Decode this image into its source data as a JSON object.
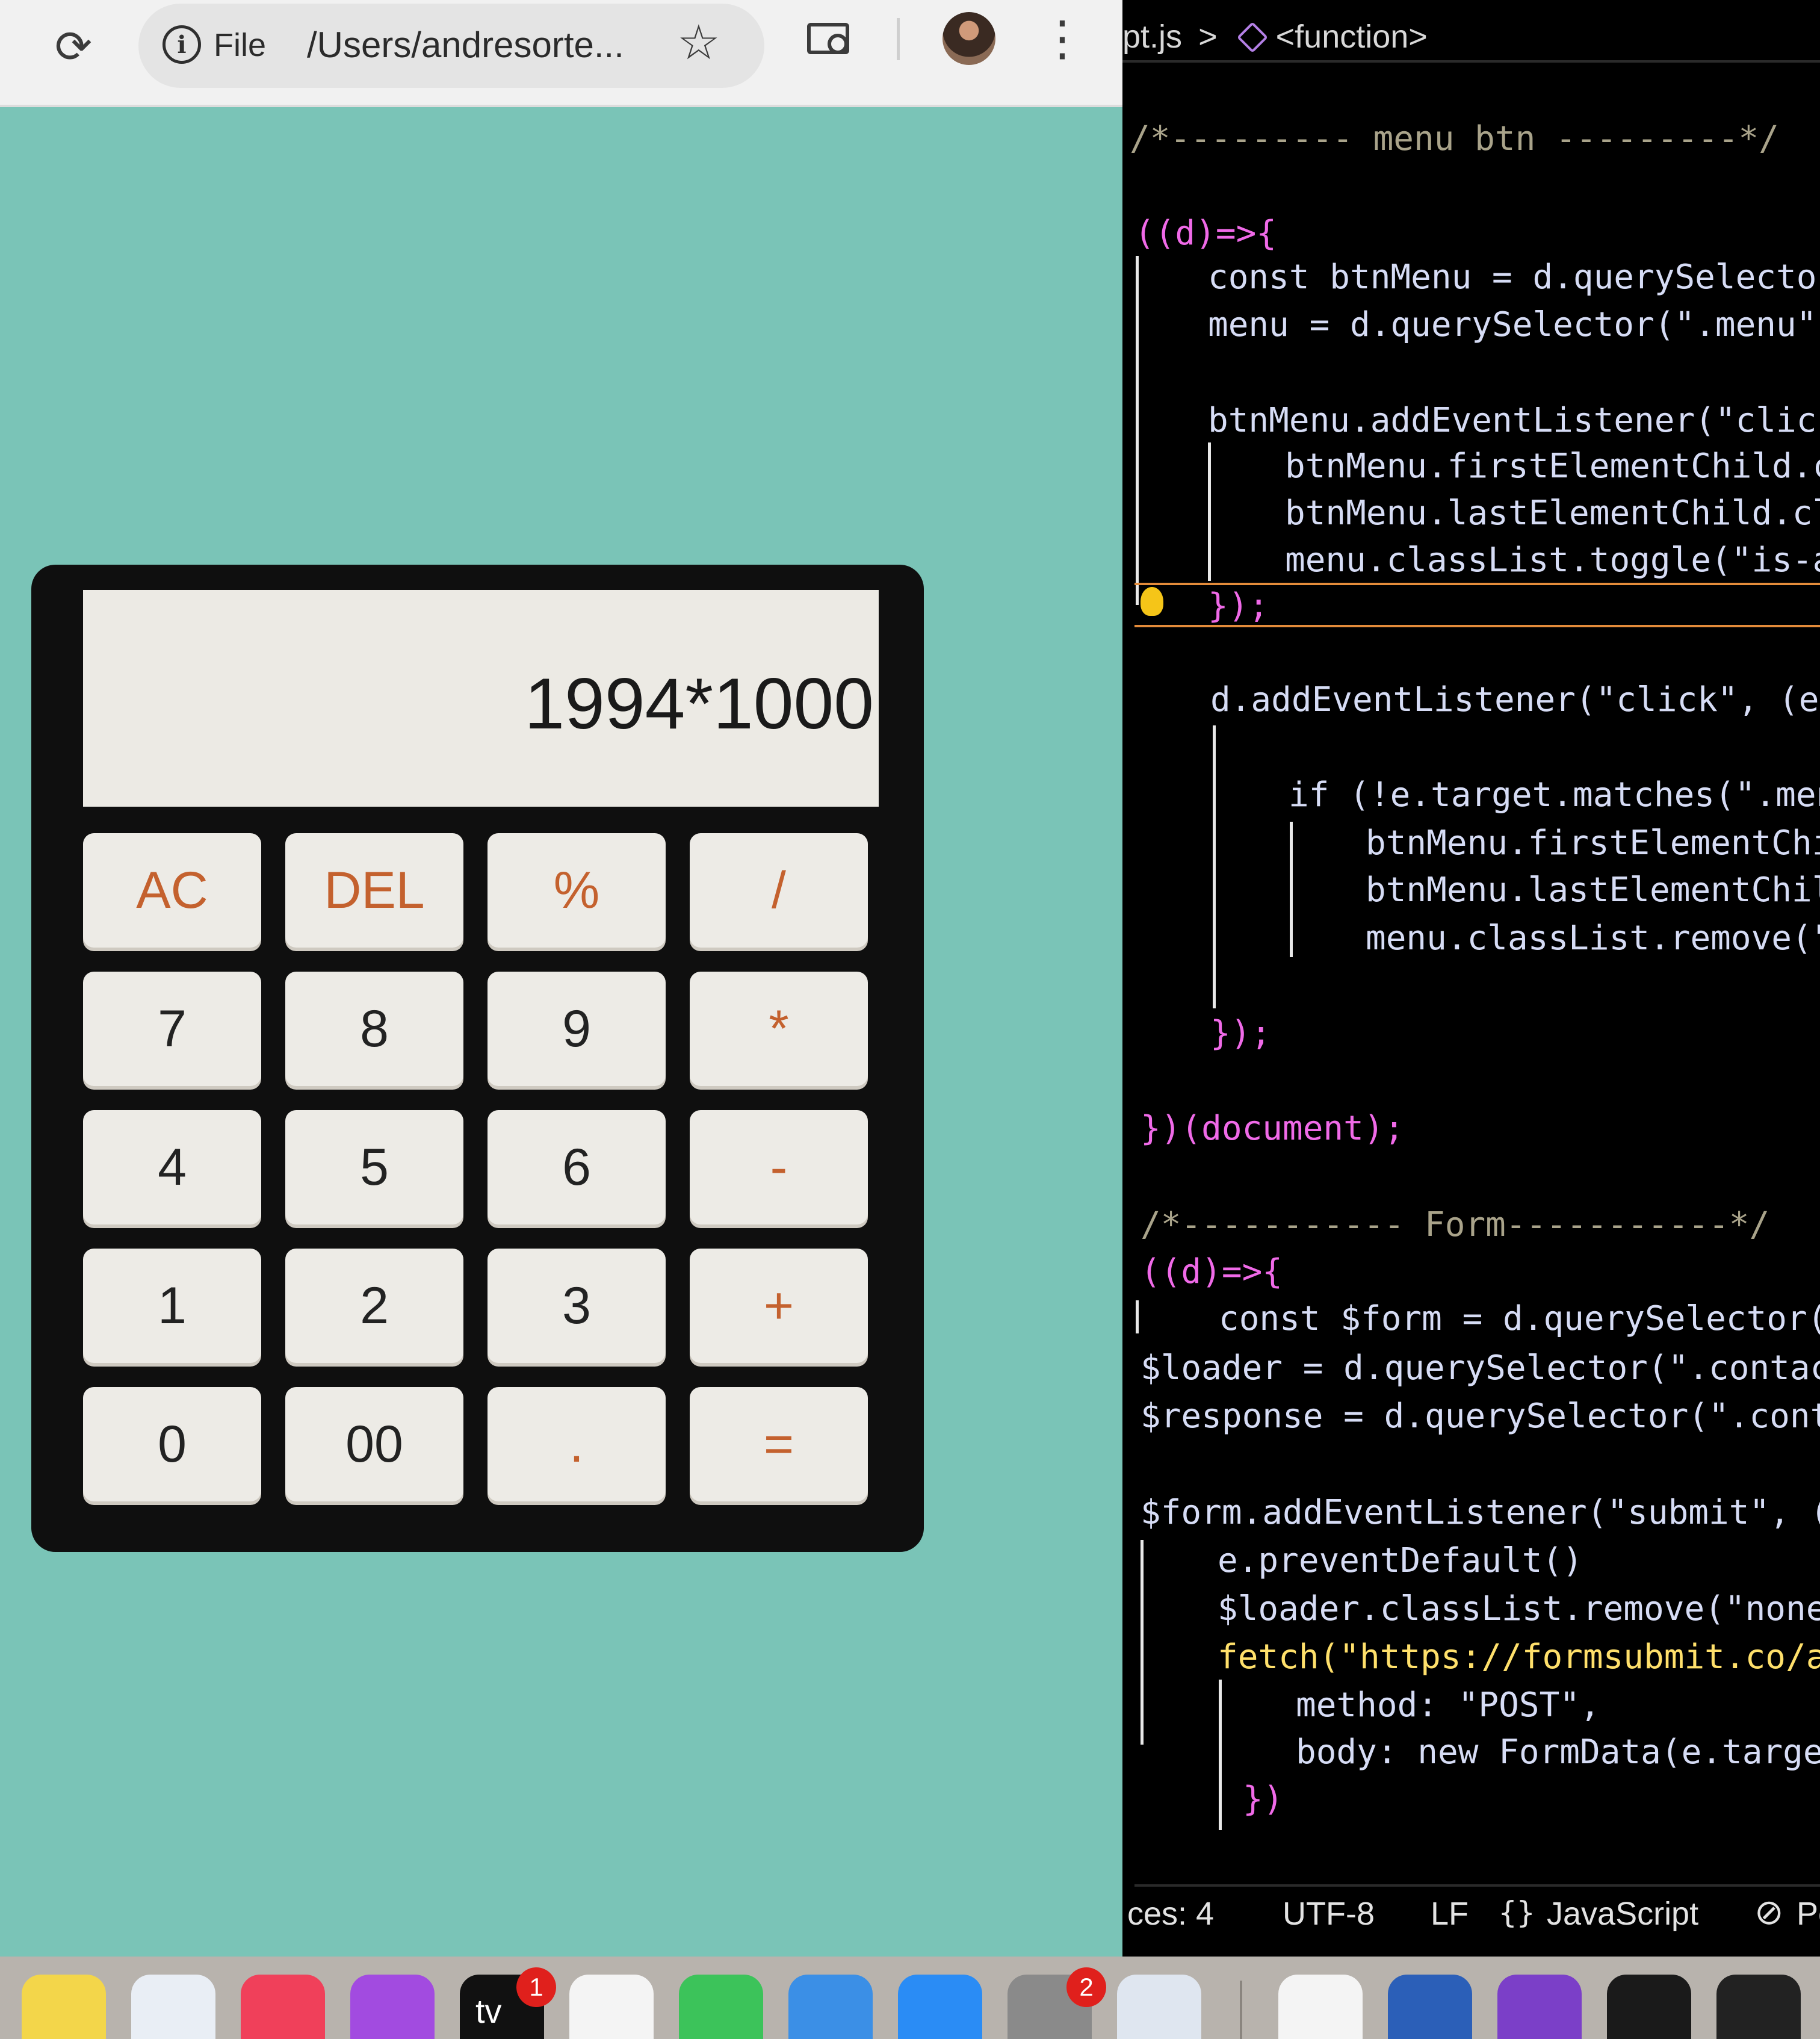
{
  "browser": {
    "address": {
      "security_label": "File",
      "url": "/Users/andresorte..."
    }
  },
  "calculator": {
    "display": "1994*1000",
    "keys": [
      {
        "label": "AC",
        "role": "operator"
      },
      {
        "label": "DEL",
        "role": "operator"
      },
      {
        "label": "%",
        "role": "operator"
      },
      {
        "label": "/",
        "role": "operator"
      },
      {
        "label": "7",
        "role": "digit"
      },
      {
        "label": "8",
        "role": "digit"
      },
      {
        "label": "9",
        "role": "digit"
      },
      {
        "label": "*",
        "role": "operator"
      },
      {
        "label": "4",
        "role": "digit"
      },
      {
        "label": "5",
        "role": "digit"
      },
      {
        "label": "6",
        "role": "digit"
      },
      {
        "label": "-",
        "role": "operator"
      },
      {
        "label": "1",
        "role": "digit"
      },
      {
        "label": "2",
        "role": "digit"
      },
      {
        "label": "3",
        "role": "digit"
      },
      {
        "label": "+",
        "role": "operator"
      },
      {
        "label": "0",
        "role": "digit"
      },
      {
        "label": "00",
        "role": "digit"
      },
      {
        "label": ".",
        "role": "operator"
      },
      {
        "label": "=",
        "role": "operator"
      }
    ]
  },
  "editor": {
    "breadcrumb": {
      "file": "pt.js",
      "separator": ">",
      "symbol": "<function>"
    },
    "code_lines": [
      "/*--------- menu btn ---------*/",
      "((d)=>{",
      "const btnMenu = d.querySelector(\"",
      "menu = d.querySelector(\".menu\");",
      "btnMenu.addEventListener(\"click\",",
      "btnMenu.firstElementChild.cl",
      "btnMenu.lastElementChild.cla",
      "menu.classList.toggle(\"is-ac",
      "});",
      "d.addEventListener(\"click\", (e)",
      "if (!e.target.matches(\".menu",
      "btnMenu.firstElementChil",
      "btnMenu.lastElementChild",
      "menu.classList.remove(\"i",
      "});",
      "})(document);",
      "/*----------- Form-----------*/",
      "((d)=>{",
      "const $form = d.querySelector(\".",
      "$loader = d.querySelector(\".contact-",
      "$response = d.querySelector(\".conta",
      "$form.addEventListener(\"submit\", (e",
      "e.preventDefault()",
      "$loader.classList.remove(\"none\"",
      "fetch(\"https://formsubmit.co/aj",
      "method: \"POST\",",
      "body: new FormData(e.target",
      "})"
    ],
    "status": {
      "spaces": "ces: 4",
      "encoding": "UTF-8",
      "eol": "LF",
      "language": "JavaScript",
      "extra": "Pc"
    }
  },
  "dock": {
    "badges": {
      "tv": "1",
      "settings": "2"
    },
    "tv_label": "tv"
  },
  "colors": {
    "page_bg": "#7ac4b7",
    "calc_body": "#0f0f0f",
    "key_bg": "#edebe6",
    "operator_text": "#c4612e",
    "comment": "#a9a38a",
    "keyword": "#6aa9ff",
    "function": "#ffe06b",
    "string": "#f0a070",
    "variable": "#d6dcf5",
    "highlight_line": "#e38b3a"
  },
  "icons": [
    "reload-icon",
    "info-icon",
    "star-icon",
    "lens-icon",
    "avatar",
    "menu-dots-icon",
    "cube-icon",
    "lightbulb-icon",
    "braces-icon",
    "no-entry-icon"
  ]
}
